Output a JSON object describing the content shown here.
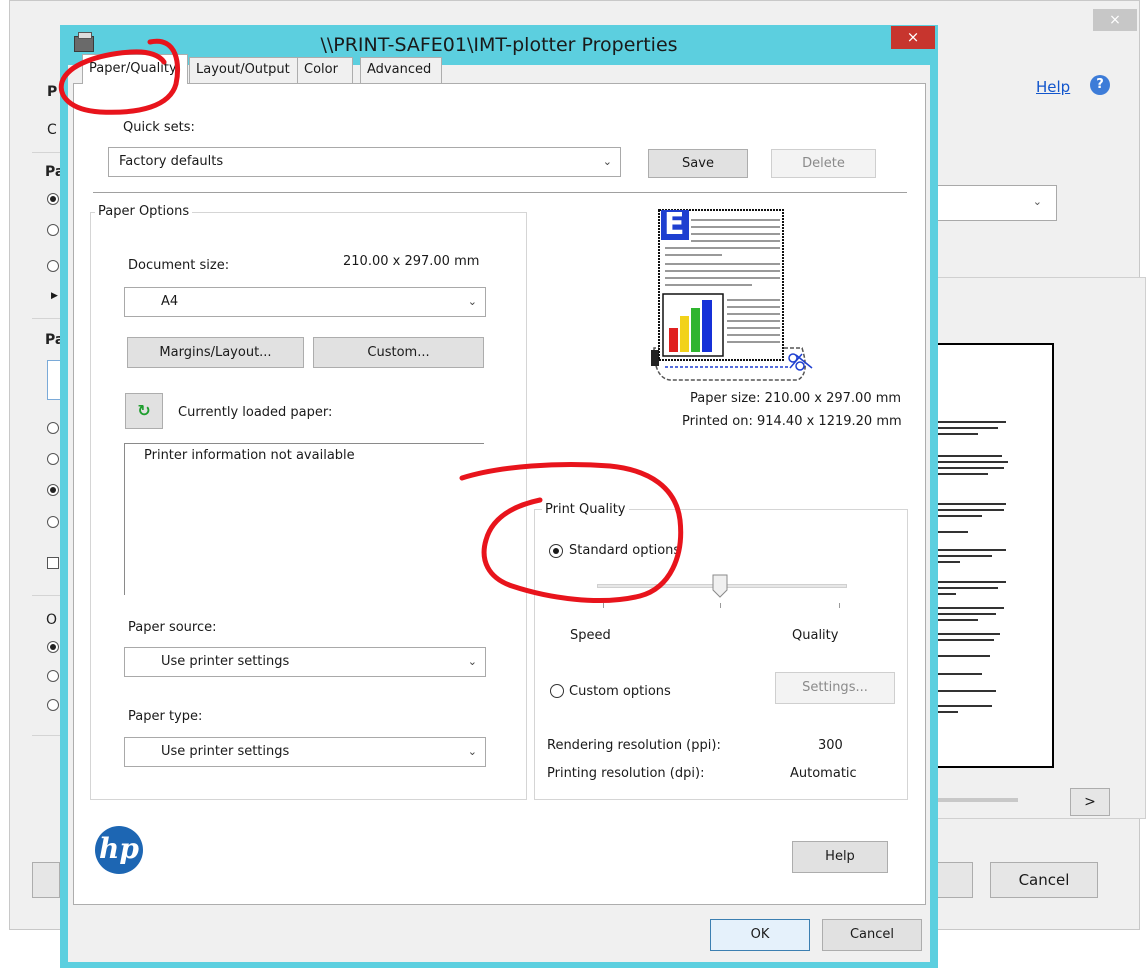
{
  "background_window": {
    "close_glyph": "×",
    "help_link": "Help",
    "help_icon_glyph": "?",
    "left_letters": [
      "P",
      "C",
      "Pa",
      "Pa",
      "O"
    ],
    "next_button": ">",
    "cancel_button": "Cancel"
  },
  "dialog": {
    "title": "\\\\PRINT-SAFE01\\IMT-plotter Properties",
    "close_glyph": "×",
    "tabs": [
      {
        "label": "Paper/Quality",
        "active": true
      },
      {
        "label": "Layout/Output",
        "active": false
      },
      {
        "label": "Color",
        "active": false
      },
      {
        "label": "Advanced",
        "active": false
      }
    ],
    "quick_sets": {
      "label": "Quick sets:",
      "value": "Factory defaults",
      "save_label": "Save",
      "delete_label": "Delete"
    },
    "paper_options": {
      "group_title": "Paper Options",
      "document_size_label": "Document size:",
      "document_size_value": "210.00 x 297.00 mm",
      "size_select_value": "A4",
      "margins_button": "Margins/Layout...",
      "custom_button": "Custom...",
      "refresh_icon_glyph": "↻",
      "loaded_paper_label": "Currently loaded paper:",
      "loaded_paper_text": "Printer information not available",
      "paper_source_label": "Paper source:",
      "paper_source_value": "Use printer settings",
      "paper_type_label": "Paper type:",
      "paper_type_value": "Use printer settings"
    },
    "preview": {
      "paper_size_text": "Paper size: 210.00 x 297.00 mm",
      "printed_on_text": "Printed on: 914.40 x 1219.20 mm",
      "page_letter": "E"
    },
    "print_quality": {
      "group_title": "Print Quality",
      "standard_option_label": "Standard options",
      "standard_selected": true,
      "slider_value_fraction": 0.5,
      "speed_label": "Speed",
      "quality_label": "Quality",
      "custom_option_label": "Custom options",
      "settings_button": "Settings...",
      "rendering_label": "Rendering resolution (ppi):",
      "rendering_value": "300",
      "printing_label": "Printing resolution (dpi):",
      "printing_value": "Automatic"
    },
    "hp_logo_text": "hp",
    "help_button": "Help",
    "ok_button": "OK",
    "cancel_button": "Cancel"
  },
  "colors": {
    "dialog_frame": "#5ccfdf",
    "close_button": "#c7352e",
    "annotation_red": "#e8141c",
    "hp_blue": "#1d66b3"
  }
}
